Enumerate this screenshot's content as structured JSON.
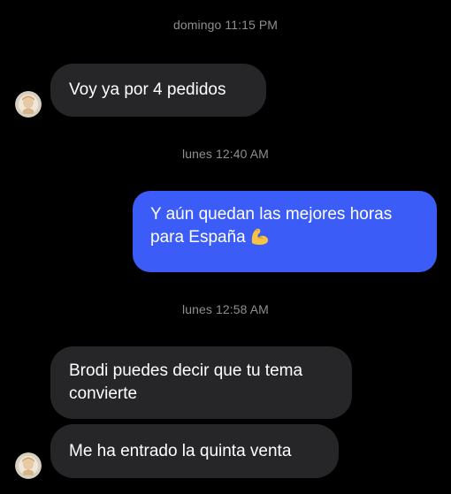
{
  "conversation": {
    "messages": [
      {
        "type": "timestamp",
        "text": "domingo 11:15 PM"
      },
      {
        "type": "incoming",
        "text": "Voy ya por 4 pedidos"
      },
      {
        "type": "timestamp",
        "text": "lunes 12:40 AM"
      },
      {
        "type": "outgoing",
        "line1": "Y aún quedan las mejores horas",
        "line2": "para España",
        "emoji": "flexed-biceps-icon"
      },
      {
        "type": "timestamp",
        "text": "lunes 12:58 AM"
      },
      {
        "type": "incoming",
        "line1": "Brodi puedes decir que tu tema",
        "line2": "convierte"
      },
      {
        "type": "incoming",
        "text": "Me ha entrado la quinta venta"
      }
    ]
  },
  "colors": {
    "background": "#000000",
    "incoming_bubble": "#262629",
    "outgoing_bubble": "#3b5cf6",
    "timestamp_text": "#8e8e93"
  }
}
